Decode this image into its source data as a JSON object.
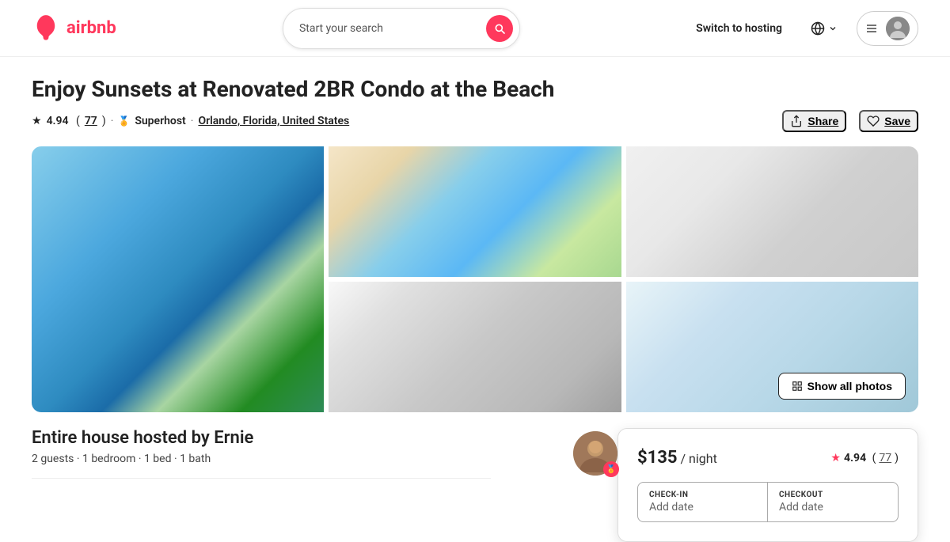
{
  "header": {
    "logo_text": "airbnb",
    "search_placeholder": "Start your search",
    "switch_hosting": "Switch to hosting",
    "nav": {
      "globe_label": "Language",
      "chevron_label": "expand"
    }
  },
  "listing": {
    "title": "Enjoy Sunsets at Renovated 2BR Condo at the Beach",
    "rating": "4.94",
    "review_count": "77",
    "superhost_label": "Superhost",
    "location": "Orlando, Florida, United States",
    "share_label": "Share",
    "save_label": "Save",
    "photos": {
      "show_all_label": "Show all photos"
    }
  },
  "host_section": {
    "title": "Entire house hosted by Ernie",
    "details": "2 guests · 1 bedroom · 1 bed · 1 bath"
  },
  "booking_card": {
    "price": "$135",
    "per_night": "/ night",
    "rating": "4.94",
    "review_count": "77",
    "checkin_label": "CHECK-IN",
    "checkin_value": "",
    "checkout_label": "CHECKOUT",
    "checkout_value": ""
  }
}
